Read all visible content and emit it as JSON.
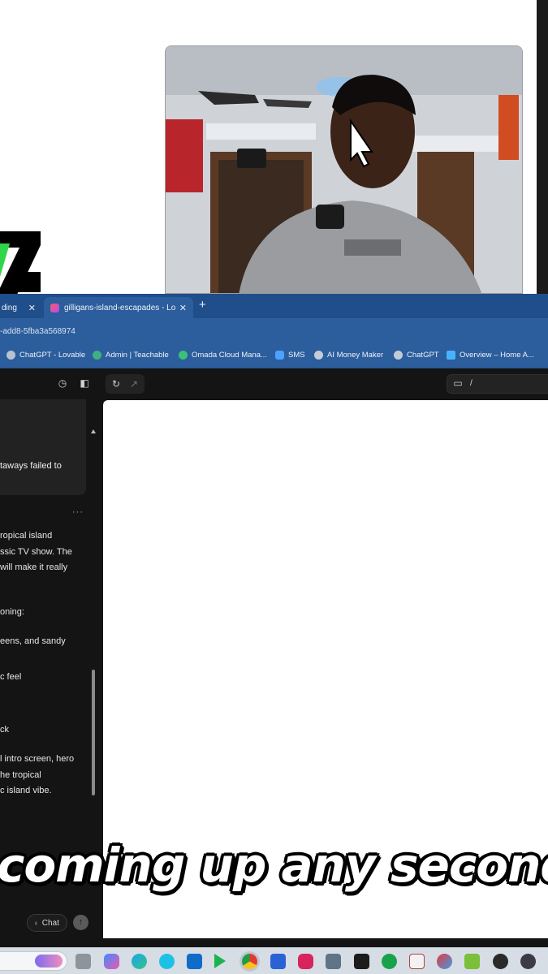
{
  "browser": {
    "tabs": [
      {
        "label": "ding",
        "close": "✕"
      },
      {
        "label": "gilligans-island-escapades - Lo",
        "close": "✕"
      }
    ],
    "new_tab": "+",
    "url": "-add8-5fba3a568974"
  },
  "bookmarks": [
    {
      "label": "ChatGPT - Lovable",
      "color": "#b9c3cf"
    },
    {
      "label": "Admin | Teachable",
      "color": "#3fb07f"
    },
    {
      "label": "Omada Cloud Mana...",
      "color": "#39c276"
    },
    {
      "label": "SMS",
      "color": "#4aa3ff"
    },
    {
      "label": "AI Money Maker",
      "color": "#c3ccd6"
    },
    {
      "label": "ChatGPT",
      "color": "#c3ccd6"
    },
    {
      "label": "Overview – Home A...",
      "color": "#47b3ff"
    }
  ],
  "app": {
    "path": "/",
    "chat": {
      "error_text": "taways failed to",
      "more": "···",
      "lines": [
        "ropical island",
        "ssic TV show. The",
        "will make it really",
        "oning:",
        "eens, and sandy",
        "c feel",
        "ck",
        "l intro screen, hero",
        "he tropical",
        "c island vibe."
      ],
      "chat_button": "Chat"
    }
  },
  "caption": "coming up any second",
  "colors": {
    "tab_bar": "#1f4e8a",
    "address_bar": "#2c5d9c",
    "app_bg": "#141414",
    "preview_bg": "#ffffff",
    "taskbar": "#d7dde4"
  },
  "taskbar_icons": [
    "task-view-icon",
    "copilot-icon",
    "edge-icon",
    "alexa-icon",
    "outlook-icon",
    "play-icon",
    "chrome-icon",
    "notepad-icon",
    "app-icon",
    "remote-icon",
    "camo-icon",
    "evernote-icon",
    "snip-icon",
    "paint-icon",
    "notes-icon",
    "chatgpt-icon",
    "obs-icon"
  ]
}
